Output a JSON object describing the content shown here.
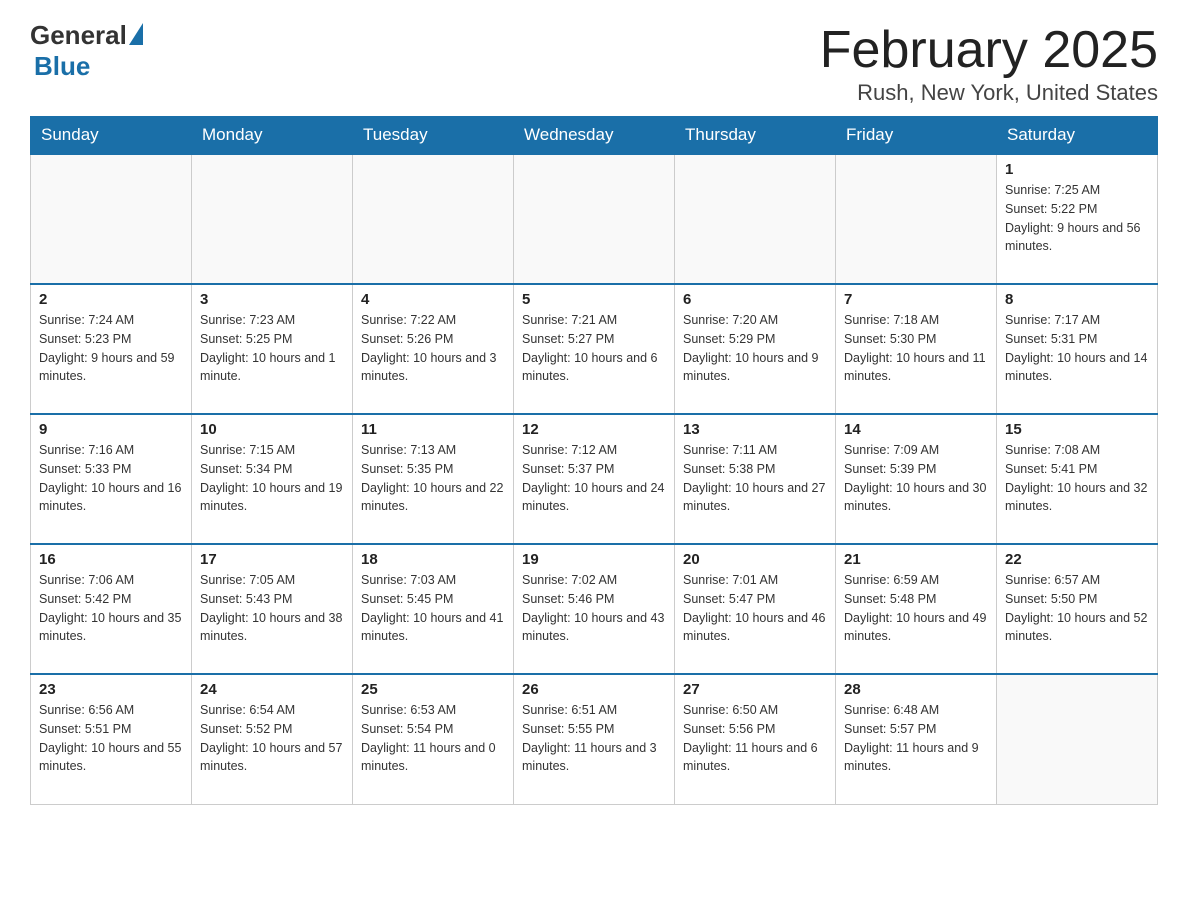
{
  "header": {
    "logo_general": "General",
    "logo_blue": "Blue",
    "month_title": "February 2025",
    "location": "Rush, New York, United States"
  },
  "days_of_week": [
    "Sunday",
    "Monday",
    "Tuesday",
    "Wednesday",
    "Thursday",
    "Friday",
    "Saturday"
  ],
  "weeks": [
    [
      {
        "day": "",
        "info": ""
      },
      {
        "day": "",
        "info": ""
      },
      {
        "day": "",
        "info": ""
      },
      {
        "day": "",
        "info": ""
      },
      {
        "day": "",
        "info": ""
      },
      {
        "day": "",
        "info": ""
      },
      {
        "day": "1",
        "info": "Sunrise: 7:25 AM\nSunset: 5:22 PM\nDaylight: 9 hours and 56 minutes."
      }
    ],
    [
      {
        "day": "2",
        "info": "Sunrise: 7:24 AM\nSunset: 5:23 PM\nDaylight: 9 hours and 59 minutes."
      },
      {
        "day": "3",
        "info": "Sunrise: 7:23 AM\nSunset: 5:25 PM\nDaylight: 10 hours and 1 minute."
      },
      {
        "day": "4",
        "info": "Sunrise: 7:22 AM\nSunset: 5:26 PM\nDaylight: 10 hours and 3 minutes."
      },
      {
        "day": "5",
        "info": "Sunrise: 7:21 AM\nSunset: 5:27 PM\nDaylight: 10 hours and 6 minutes."
      },
      {
        "day": "6",
        "info": "Sunrise: 7:20 AM\nSunset: 5:29 PM\nDaylight: 10 hours and 9 minutes."
      },
      {
        "day": "7",
        "info": "Sunrise: 7:18 AM\nSunset: 5:30 PM\nDaylight: 10 hours and 11 minutes."
      },
      {
        "day": "8",
        "info": "Sunrise: 7:17 AM\nSunset: 5:31 PM\nDaylight: 10 hours and 14 minutes."
      }
    ],
    [
      {
        "day": "9",
        "info": "Sunrise: 7:16 AM\nSunset: 5:33 PM\nDaylight: 10 hours and 16 minutes."
      },
      {
        "day": "10",
        "info": "Sunrise: 7:15 AM\nSunset: 5:34 PM\nDaylight: 10 hours and 19 minutes."
      },
      {
        "day": "11",
        "info": "Sunrise: 7:13 AM\nSunset: 5:35 PM\nDaylight: 10 hours and 22 minutes."
      },
      {
        "day": "12",
        "info": "Sunrise: 7:12 AM\nSunset: 5:37 PM\nDaylight: 10 hours and 24 minutes."
      },
      {
        "day": "13",
        "info": "Sunrise: 7:11 AM\nSunset: 5:38 PM\nDaylight: 10 hours and 27 minutes."
      },
      {
        "day": "14",
        "info": "Sunrise: 7:09 AM\nSunset: 5:39 PM\nDaylight: 10 hours and 30 minutes."
      },
      {
        "day": "15",
        "info": "Sunrise: 7:08 AM\nSunset: 5:41 PM\nDaylight: 10 hours and 32 minutes."
      }
    ],
    [
      {
        "day": "16",
        "info": "Sunrise: 7:06 AM\nSunset: 5:42 PM\nDaylight: 10 hours and 35 minutes."
      },
      {
        "day": "17",
        "info": "Sunrise: 7:05 AM\nSunset: 5:43 PM\nDaylight: 10 hours and 38 minutes."
      },
      {
        "day": "18",
        "info": "Sunrise: 7:03 AM\nSunset: 5:45 PM\nDaylight: 10 hours and 41 minutes."
      },
      {
        "day": "19",
        "info": "Sunrise: 7:02 AM\nSunset: 5:46 PM\nDaylight: 10 hours and 43 minutes."
      },
      {
        "day": "20",
        "info": "Sunrise: 7:01 AM\nSunset: 5:47 PM\nDaylight: 10 hours and 46 minutes."
      },
      {
        "day": "21",
        "info": "Sunrise: 6:59 AM\nSunset: 5:48 PM\nDaylight: 10 hours and 49 minutes."
      },
      {
        "day": "22",
        "info": "Sunrise: 6:57 AM\nSunset: 5:50 PM\nDaylight: 10 hours and 52 minutes."
      }
    ],
    [
      {
        "day": "23",
        "info": "Sunrise: 6:56 AM\nSunset: 5:51 PM\nDaylight: 10 hours and 55 minutes."
      },
      {
        "day": "24",
        "info": "Sunrise: 6:54 AM\nSunset: 5:52 PM\nDaylight: 10 hours and 57 minutes."
      },
      {
        "day": "25",
        "info": "Sunrise: 6:53 AM\nSunset: 5:54 PM\nDaylight: 11 hours and 0 minutes."
      },
      {
        "day": "26",
        "info": "Sunrise: 6:51 AM\nSunset: 5:55 PM\nDaylight: 11 hours and 3 minutes."
      },
      {
        "day": "27",
        "info": "Sunrise: 6:50 AM\nSunset: 5:56 PM\nDaylight: 11 hours and 6 minutes."
      },
      {
        "day": "28",
        "info": "Sunrise: 6:48 AM\nSunset: 5:57 PM\nDaylight: 11 hours and 9 minutes."
      },
      {
        "day": "",
        "info": ""
      }
    ]
  ]
}
